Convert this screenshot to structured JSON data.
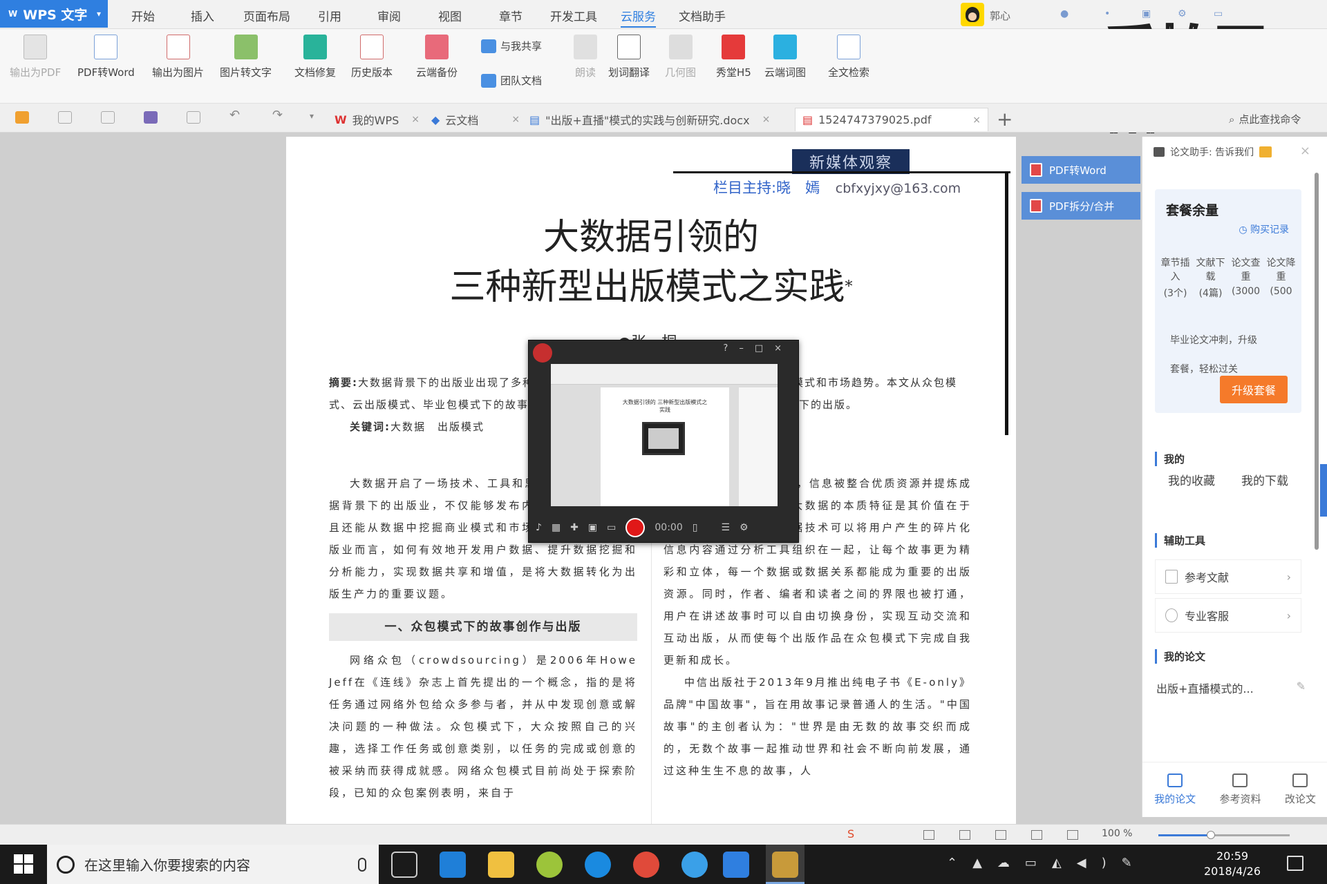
{
  "app": {
    "name": "WPS 文字"
  },
  "menu": {
    "items": [
      "开始",
      "插入",
      "页面布局",
      "引用",
      "审阅",
      "视图",
      "章节",
      "开发工具",
      "云服务",
      "文档助手"
    ],
    "active": "云服务",
    "user": "郭心"
  },
  "watermark": "爱拍原创",
  "ribbon": {
    "buttons": [
      {
        "label": "输出为PDF",
        "disabled": true
      },
      {
        "label": "PDF转Word"
      },
      {
        "label": "输出为图片"
      },
      {
        "label": "图片转文字"
      },
      {
        "label": "文档修复"
      },
      {
        "label": "历史版本"
      },
      {
        "label": "云端备份"
      },
      {
        "label": "朗读",
        "disabled": true
      },
      {
        "label": "划词翻译"
      },
      {
        "label": "几何图",
        "disabled": true
      },
      {
        "label": "秀堂H5"
      },
      {
        "label": "云端词图"
      },
      {
        "label": "全文检索"
      }
    ],
    "share_label": "与我共享",
    "team_label": "团队文档"
  },
  "tabs": [
    {
      "label": "我的WPS"
    },
    {
      "label": "云文档"
    },
    {
      "label": "\"出版+直播\"模式的实践与创新研究.docx"
    },
    {
      "label": "1524747379025.pdf",
      "active": true
    }
  ],
  "find_command": "点此查找命令",
  "document": {
    "header_tag": "新媒体观察",
    "column_host": "栏目主持:晓　嫣",
    "column_email": "cbfxyjxy@163.com",
    "title_line1": "大数据引领的",
    "title_line2": "三种新型出版模式之实践",
    "title_mark": "*",
    "author": "●张　桐",
    "abstract_label": "摘要:",
    "abstract": "大数据背景下的出版业出现了多种新型出版模式，在这些出版模式中发现潜在的商业模式和市场趋势。本文从众包模式、云出版模式、毕业包模式下的故事创作与出版、预测译文与精准出版三方面论述大数据下的出版。",
    "keywords_label": "关键词:",
    "keywords": "大数据　出版模式",
    "left_para1": "大数据开启了一场技术、工具和思维上的变革。大数据背景下的出版业，不仅能够发布内容的信息产品，而且还能从数据中挖掘商业模式和市场趋势。对目前的出版业而言，如何有效地开发用户数据、提升数据挖掘和分析能力，实现数据共享和增值，是将大数据转化为出版生产力的重要议题。",
    "section1": "一、众包模式下的故事创作与出版",
    "left_para2": "网络众包（crowdsourcing）是2006年Howe Jeff在《连线》杂志上首先提出的一个概念，指的是将任务通过网络外包给众多参与者，并从中发现创意或解决问题的一种做法。众包模式下，大众按照自己的兴趣，选择工作任务或创意类别，以任务的完成或创意的被采纳而获得成就感。网络众包模式目前尚处于探索阶段，已知的众包案例表明，来自于",
    "right_para1": "在开放的出版链条中，信息被整合优质资源并提炼成出版内容的关键问题。大数据的本质特征是其价值在于从知识挖掘价值。大数据技术可以将用户产生的碎片化信息内容通过分析工具组织在一起，让每个故事更为精彩和立体，每一个数据或数据关系都能成为重要的出版资源。同时，作者、编者和读者之间的界限也被打通，用户在讲述故事时可以自由切换身份，实现互动交流和互动出版，从而使每个出版作品在众包模式下完成自我更新和成长。",
    "right_para2": "中信出版社于2013年9月推出纯电子书《E-only》品牌\"中国故事\"，旨在用故事记录普通人的生活。\"中国故事\"的主创者认为：\"世界是由无数的故事交织而成的，无数个故事一起推动世界和社会不断向前发展，通过这种生生不息的故事，人"
  },
  "pdf_buttons": [
    "PDF转Word",
    "PDF拆分/合并"
  ],
  "right_pane": {
    "title": "论文助手: 告诉我们",
    "quota_title": "套餐余量",
    "purchase_link": "购买记录",
    "quota_cols": [
      {
        "name": "章节插入",
        "value": "(3个)"
      },
      {
        "name": "文献下载",
        "value": "(4篇)"
      },
      {
        "name": "论文查重",
        "value": "(3000"
      },
      {
        "name": "论文降重",
        "value": "(500"
      }
    ],
    "quota_note_1": "毕业论文冲刺，升级",
    "quota_note_2": "套餐，轻松过关",
    "upgrade_label": "升级套餐",
    "section_mine": "我的",
    "my_download": "我的收藏",
    "my_favorite": "我的下载",
    "section_tools": "辅助工具",
    "tool_refs": "参考文献",
    "tool_service": "专业客服",
    "section_papers": "我的论文",
    "paper_item": "出版+直播模式的...",
    "bottom_tabs": [
      "我的论文",
      "参考资料",
      "改论文"
    ]
  },
  "recorder": {
    "time": "00:00",
    "preview_title": "大数据引领的 三种新型出版模式之实践"
  },
  "status": {
    "zoom": "100 %",
    "zoom_fraction": 0.4
  },
  "taskbar": {
    "search_placeholder": "在这里输入你要搜索的内容",
    "time": "20:59",
    "date": "2018/4/26"
  },
  "colors": {
    "accent": "#2f7fe0",
    "upgrade": "#f57a2a",
    "record": "#e01818"
  }
}
